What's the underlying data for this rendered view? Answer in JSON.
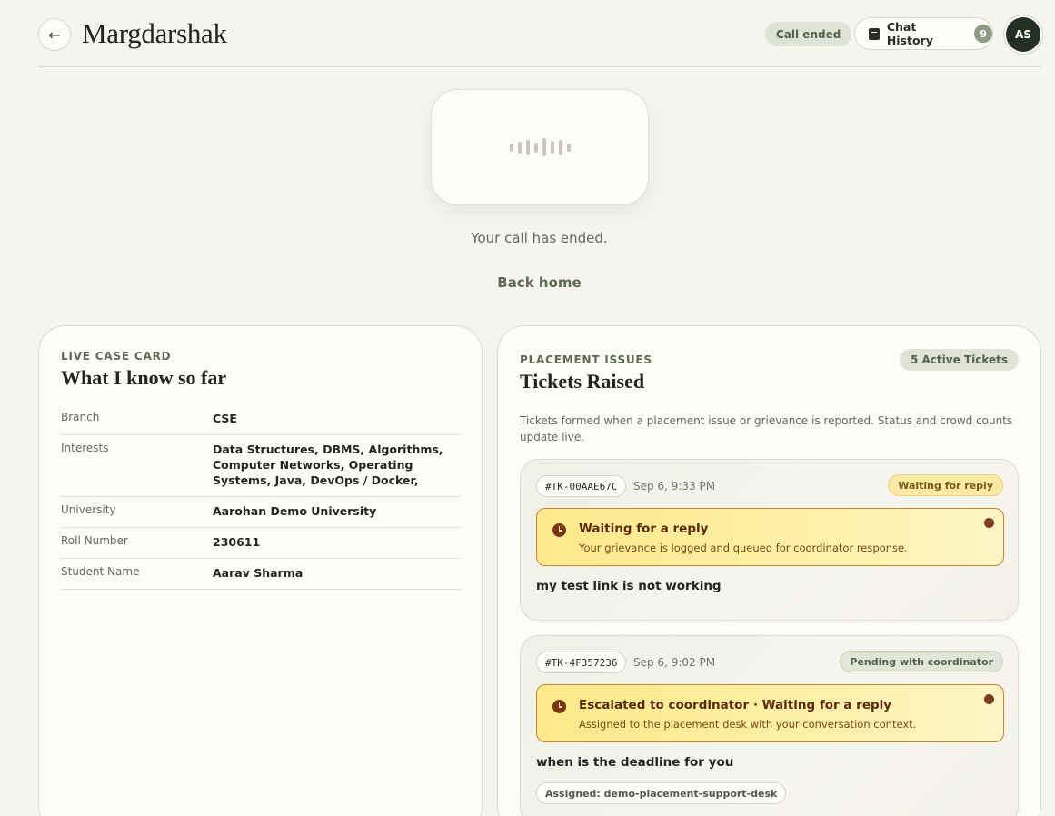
{
  "header": {
    "back_icon": "←",
    "app_title": "Margdarshak",
    "call_status": "Call ended",
    "chat_history_label": "Chat History",
    "chat_history_count": "9",
    "avatar_initials": "AS"
  },
  "call": {
    "ended_text": "Your call has ended.",
    "back_home_label": "Back home"
  },
  "case_card": {
    "eyebrow": "LIVE CASE CARD",
    "title": "What I know so far",
    "fields": [
      {
        "key": "Branch",
        "value": "CSE"
      },
      {
        "key": "Interests",
        "value": "Data Structures, DBMS, Algorithms, Computer Networks, Operating Systems, Java, DevOps / Docker,"
      },
      {
        "key": "University",
        "value": "Aarohan Demo University"
      },
      {
        "key": "Roll Number",
        "value": "230611"
      },
      {
        "key": "Student Name",
        "value": "Aarav Sharma"
      }
    ]
  },
  "tickets_panel": {
    "eyebrow": "PLACEMENT ISSUES",
    "title": "Tickets Raised",
    "badge": "5 Active Tickets",
    "description": "Tickets formed when a placement issue or grievance is reported. Status and crowd counts update live.",
    "tickets": [
      {
        "id": "#TK-00AAE67C",
        "time": "Sep 6, 9:33 PM",
        "status": "Waiting for reply",
        "alert_title": "Waiting for a reply",
        "alert_sub": "Your grievance is logged and queued for coordinator response.",
        "text": "my test link is not working",
        "assigned": ""
      },
      {
        "id": "#TK-4F357236",
        "time": "Sep 6, 9:02 PM",
        "status": "Pending with coordinator",
        "alert_title": "Escalated to coordinator · Waiting for a reply",
        "alert_sub": "Assigned to the placement desk with your conversation context.",
        "text": "when is the deadline for you",
        "assigned": "Assigned: demo-placement-support-desk"
      }
    ]
  },
  "colors": {
    "background": "#f6f4ee",
    "accent_green": "#5c6a52",
    "alert_yellow": "#fde98a",
    "alert_border": "#c9862a"
  }
}
